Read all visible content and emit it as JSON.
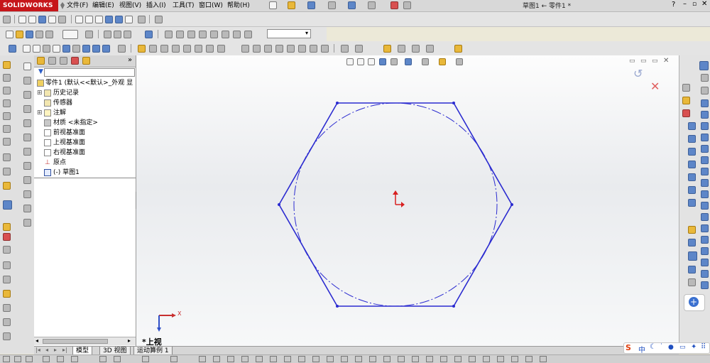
{
  "app": {
    "logo_text": "SOLIDWORKS",
    "window_title": "草图1 ← 零件1 *",
    "menus": [
      "文件(F)",
      "编辑(E)",
      "视图(V)",
      "插入(I)",
      "工具(T)",
      "窗口(W)",
      "帮助(H)"
    ]
  },
  "feature_tree": {
    "root_label": "零件1  (默认<<默认>_外观 显",
    "items": [
      {
        "label": "历史记录",
        "icon": "history-icon"
      },
      {
        "label": "传感器",
        "icon": "sensor-icon"
      },
      {
        "label": "注解",
        "icon": "annotation-icon"
      },
      {
        "label": "材质 <未指定>",
        "icon": "material-icon"
      },
      {
        "label": "前视基准面",
        "icon": "plane-icon"
      },
      {
        "label": "上视基准面",
        "icon": "plane-icon"
      },
      {
        "label": "右视基准面",
        "icon": "plane-icon"
      },
      {
        "label": "原点",
        "icon": "origin-icon"
      },
      {
        "label": "(-) 草图1",
        "icon": "sketch-icon"
      }
    ]
  },
  "viewport": {
    "view_label": "*上视",
    "axis_x_label": "X",
    "sketch": {
      "shape": "regular hexagon with inscribed construction circle",
      "line_color": "#2b2bd0",
      "origin_color": "#d82020"
    }
  },
  "bottom_tabs": [
    "模型",
    "3D 视图",
    "运动算例 1"
  ],
  "tray": {
    "ime": "中"
  }
}
